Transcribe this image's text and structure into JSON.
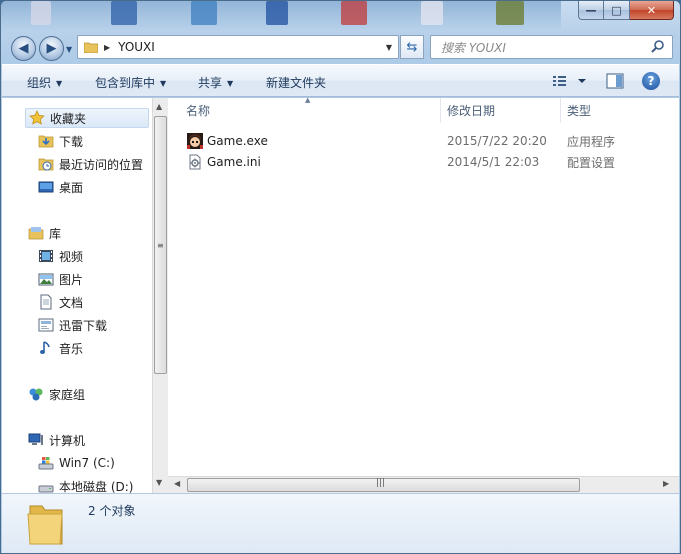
{
  "window": {
    "controls": {
      "minimize": "—",
      "maximize": "□",
      "close": "✕"
    }
  },
  "address_bar": {
    "path_segment": "YOUXI",
    "search_placeholder": "搜索 YOUXI"
  },
  "toolbar": {
    "organize": "组织",
    "include_in_library": "包含到库中",
    "share": "共享",
    "new_folder": "新建文件夹",
    "help": "?"
  },
  "nav_pane": {
    "favorites": {
      "label": "收藏夹",
      "items": [
        {
          "label": "下载",
          "icon": "download-folder-icon"
        },
        {
          "label": "最近访问的位置",
          "icon": "recent-places-icon"
        },
        {
          "label": "桌面",
          "icon": "desktop-icon"
        }
      ]
    },
    "libraries": {
      "label": "库",
      "items": [
        {
          "label": "视频",
          "icon": "video-library-icon"
        },
        {
          "label": "图片",
          "icon": "pictures-library-icon"
        },
        {
          "label": "文档",
          "icon": "documents-library-icon"
        },
        {
          "label": "迅雷下载",
          "icon": "thunder-download-icon"
        },
        {
          "label": "音乐",
          "icon": "music-library-icon"
        }
      ]
    },
    "homegroup": {
      "label": "家庭组"
    },
    "computer": {
      "label": "计算机",
      "items": [
        {
          "label": "Win7 (C:)",
          "icon": "system-drive-icon"
        },
        {
          "label": "本地磁盘 (D:)",
          "icon": "local-disk-icon"
        }
      ]
    }
  },
  "file_list": {
    "columns": {
      "name": "名称",
      "date": "修改日期",
      "type": "类型"
    },
    "rows": [
      {
        "name": "Game.exe",
        "date": "2015/7/22 20:20",
        "type": "应用程序",
        "icon": "game-exe-icon"
      },
      {
        "name": "Game.ini",
        "date": "2014/5/1 22:03",
        "type": "配置设置",
        "icon": "config-file-icon"
      }
    ]
  },
  "status": {
    "item_count": "2 个对象"
  },
  "colors": {
    "window_frame": "#aecbe8",
    "pane_background": "#ffffff",
    "selection": "#dbe8f7",
    "link_text": "#1e395b"
  }
}
